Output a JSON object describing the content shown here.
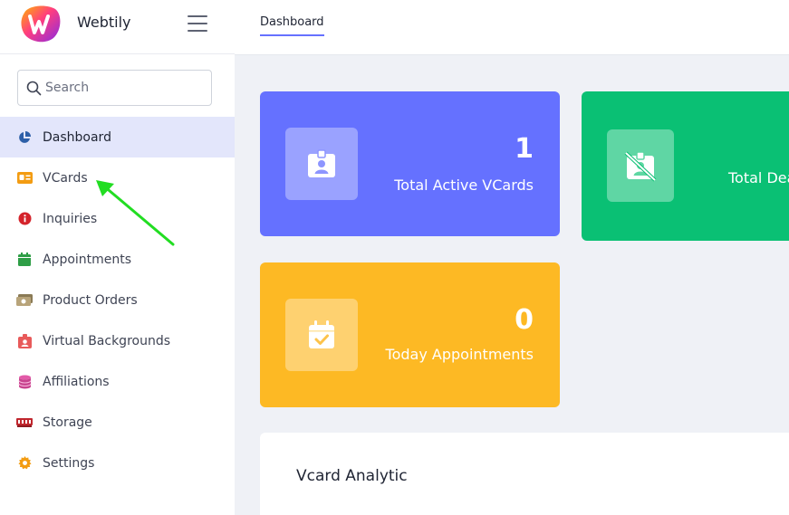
{
  "brand": {
    "name": "Webtily",
    "logo_icon": "webtily-logo-icon"
  },
  "search": {
    "placeholder": "Search",
    "value": ""
  },
  "sidebar": {
    "items": [
      {
        "label": "Dashboard",
        "icon": "pie-chart-icon",
        "active": true
      },
      {
        "label": "VCards",
        "icon": "id-card-icon",
        "active": false
      },
      {
        "label": "Inquiries",
        "icon": "info-icon",
        "active": false
      },
      {
        "label": "Appointments",
        "icon": "calendar-icon",
        "active": false
      },
      {
        "label": "Product Orders",
        "icon": "money-icon",
        "active": false
      },
      {
        "label": "Virtual Backgrounds",
        "icon": "badge-icon",
        "active": false
      },
      {
        "label": "Affiliations",
        "icon": "coins-icon",
        "active": false
      },
      {
        "label": "Storage",
        "icon": "memory-icon",
        "active": false
      },
      {
        "label": "Settings",
        "icon": "gear-icon",
        "active": false
      }
    ]
  },
  "topbar": {
    "tab_label": "Dashboard"
  },
  "cards": [
    {
      "value": "1",
      "label": "Total Active VCards",
      "icon": "id-badge-icon",
      "color": "#6571ff"
    },
    {
      "value": "",
      "label": "Total Dea",
      "icon": "id-badge-slash-icon",
      "color": "#0ac074"
    },
    {
      "value": "0",
      "label": "Today Appointments",
      "icon": "calendar-check-icon",
      "color": "#fdb924"
    }
  ],
  "panel": {
    "title": "Vcard Analytic"
  },
  "colors": {
    "accent": "#6571ff",
    "active_bg": "#e3e6fb",
    "annotation_arrow": "#22dd22"
  }
}
